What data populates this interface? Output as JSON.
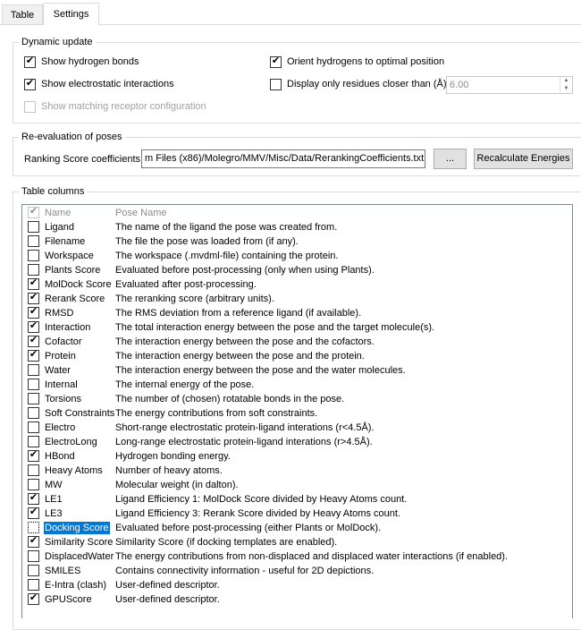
{
  "tabs": [
    {
      "label": "Table",
      "active": false
    },
    {
      "label": "Settings",
      "active": true
    }
  ],
  "dynamic_update": {
    "title": "Dynamic update",
    "show_hbonds": {
      "label": "Show hydrogen bonds",
      "checked": true
    },
    "show_electrostatic": {
      "label": "Show electrostatic interactions",
      "checked": true
    },
    "show_matching_receptor": {
      "label": "Show matching receptor configuration",
      "checked": false,
      "enabled": false
    },
    "orient_hydrogens": {
      "label": "Orient hydrogens to optimal position",
      "checked": true
    },
    "display_closer": {
      "label": "Display only residues closer than (Å):",
      "checked": false
    },
    "distance_value": "6.00"
  },
  "reevaluation": {
    "title": "Re-evaluation of poses",
    "ranking_label": "Ranking Score coefficients",
    "ranking_path": "m Files (x86)/Molegro/MMV/Misc/Data/RerankingCoefficients.txt",
    "browse_label": "...",
    "recalc_label": "Recalculate Energies"
  },
  "table_columns": {
    "title": "Table columns",
    "header": {
      "name": "Name",
      "desc": "Pose Name",
      "checked": true
    },
    "rows": [
      {
        "name": "Ligand",
        "desc": "The name of the ligand the pose was created from.",
        "checked": false
      },
      {
        "name": "Filename",
        "desc": "The file the pose was loaded from (if any).",
        "checked": false
      },
      {
        "name": "Workspace",
        "desc": "The workspace (.mvdml-file) containing the protein.",
        "checked": false
      },
      {
        "name": "Plants Score",
        "desc": "Evaluated before post-processing (only when using Plants).",
        "checked": false
      },
      {
        "name": "MolDock Score",
        "desc": "Evaluated after post-processing.",
        "checked": true
      },
      {
        "name": "Rerank Score",
        "desc": "The reranking score (arbitrary units).",
        "checked": true
      },
      {
        "name": "RMSD",
        "desc": "The RMS deviation from a reference ligand (if available).",
        "checked": true
      },
      {
        "name": "Interaction",
        "desc": "The total interaction energy between the pose and the target molecule(s).",
        "checked": true
      },
      {
        "name": "Cofactor",
        "desc": "The interaction energy between the pose and the cofactors.",
        "checked": true
      },
      {
        "name": "Protein",
        "desc": "The interaction energy between the pose and the protein.",
        "checked": true
      },
      {
        "name": "Water",
        "desc": "The interaction energy between the pose and the water molecules.",
        "checked": false
      },
      {
        "name": "Internal",
        "desc": "The internal energy of the pose.",
        "checked": false
      },
      {
        "name": "Torsions",
        "desc": "The number of (chosen) rotatable bonds in the pose.",
        "checked": false
      },
      {
        "name": "Soft Constraints",
        "desc": "The energy contributions from soft constraints.",
        "checked": false
      },
      {
        "name": "Electro",
        "desc": "Short-range electrostatic protein-ligand interations (r<4.5Å).",
        "checked": false
      },
      {
        "name": "ElectroLong",
        "desc": "Long-range electrostatic protein-ligand interations (r>4.5Å).",
        "checked": false
      },
      {
        "name": "HBond",
        "desc": "Hydrogen bonding energy.",
        "checked": true
      },
      {
        "name": "Heavy Atoms",
        "desc": "Number of heavy atoms.",
        "checked": false
      },
      {
        "name": "MW",
        "desc": "Molecular weight (in dalton).",
        "checked": false
      },
      {
        "name": "LE1",
        "desc": "Ligand Efficiency 1: MolDock Score divided by Heavy Atoms count.",
        "checked": true
      },
      {
        "name": "LE3",
        "desc": "Ligand Efficiency 3: Rerank Score divided by Heavy Atoms count.",
        "checked": true
      },
      {
        "name": "Docking Score",
        "desc": "Evaluated before post-processing (either Plants or MolDock).",
        "checked": false,
        "selected": true
      },
      {
        "name": "Similarity Score",
        "desc": "Similarity Score (if docking templates are enabled).",
        "checked": true
      },
      {
        "name": "DisplacedWater",
        "desc": "The energy contributions from non-displaced and displaced water interactions (if enabled).",
        "checked": false
      },
      {
        "name": "SMILES",
        "desc": "Contains connectivity information - useful for 2D depictions.",
        "checked": false
      },
      {
        "name": "E-Intra (clash)",
        "desc": "User-defined descriptor.",
        "checked": false
      },
      {
        "name": "GPUScore",
        "desc": "User-defined descriptor.",
        "checked": true
      }
    ]
  },
  "icons": {
    "check": "check-icon",
    "spin_up": "spin-up-icon",
    "spin_down": "spin-down-icon"
  },
  "colors": {
    "selection": "#0078d7",
    "disabled_text": "#a0a0a0"
  }
}
